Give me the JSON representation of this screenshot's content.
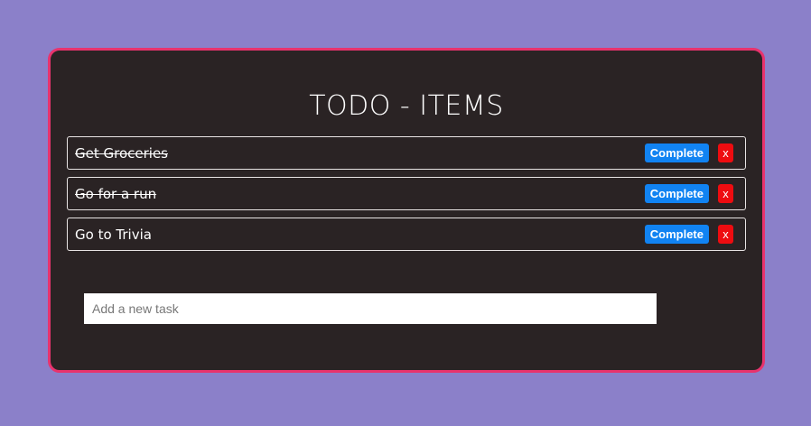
{
  "app": {
    "title": "TODO - ITEMS"
  },
  "todos": [
    {
      "text": "Get Groceries",
      "completed": true,
      "complete_label": "Complete",
      "delete_label": "x"
    },
    {
      "text": "Go for a run",
      "completed": true,
      "complete_label": "Complete",
      "delete_label": "x"
    },
    {
      "text": "Go to Trivia",
      "completed": false,
      "complete_label": "Complete",
      "delete_label": "x"
    }
  ],
  "new_task": {
    "value": "",
    "placeholder": "Add a new task"
  },
  "colors": {
    "page_background": "#8b80c9",
    "card_background": "#2a2324",
    "card_border": "#e8336d",
    "complete_button": "#1183f2",
    "delete_button": "#ee0c10"
  }
}
